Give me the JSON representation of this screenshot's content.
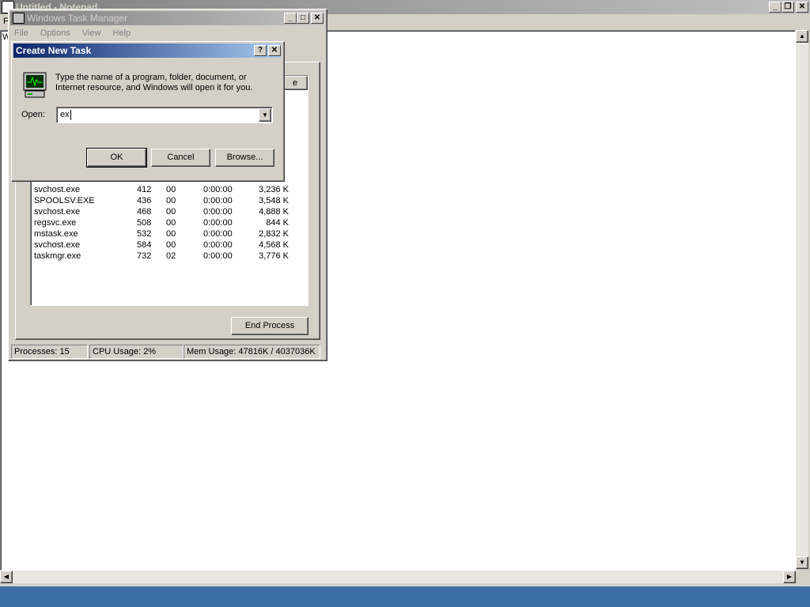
{
  "notepad": {
    "title": "Untitled - Notepad",
    "menu_letter_f": "F",
    "text_letter": "W"
  },
  "taskmgr": {
    "title": "Windows Task Manager",
    "menu": [
      "File",
      "Options",
      "View",
      "Help"
    ],
    "partial_header": "e",
    "processes": [
      {
        "name": "svchost.exe",
        "pid": "412",
        "cpu": "00",
        "time": "0:00:00",
        "mem": "3,236 K"
      },
      {
        "name": "SPOOLSV.EXE",
        "pid": "436",
        "cpu": "00",
        "time": "0:00:00",
        "mem": "3,548 K"
      },
      {
        "name": "svchost.exe",
        "pid": "468",
        "cpu": "00",
        "time": "0:00:00",
        "mem": "4,888 K"
      },
      {
        "name": "regsvc.exe",
        "pid": "508",
        "cpu": "00",
        "time": "0:00:00",
        "mem": "844 K"
      },
      {
        "name": "mstask.exe",
        "pid": "532",
        "cpu": "00",
        "time": "0:00:00",
        "mem": "2,832 K"
      },
      {
        "name": "svchost.exe",
        "pid": "584",
        "cpu": "00",
        "time": "0:00:00",
        "mem": "4,568 K"
      },
      {
        "name": "taskmgr.exe",
        "pid": "732",
        "cpu": "02",
        "time": "0:00:00",
        "mem": "3,776 K"
      }
    ],
    "end_process_label": "End Process",
    "status": {
      "processes": "Processes: 15",
      "cpu": "CPU Usage: 2%",
      "mem": "Mem Usage: 47816K / 4037036K"
    }
  },
  "dialog": {
    "title": "Create New Task",
    "help_label": "?",
    "close_label": "✕",
    "description": "Type the name of a program, folder, document, or Internet resource, and Windows will open it for you.",
    "open_label": "Open:",
    "open_value": "ex",
    "ok_label": "OK",
    "cancel_label": "Cancel",
    "browse_label": "Browse..."
  },
  "colors": {
    "title_active": "#0a246a",
    "title_active_end": "#a6caf0",
    "title_inactive": "#808080",
    "title_inactive_end": "#c0c0c0",
    "taskbar": "#3a6ea5"
  }
}
